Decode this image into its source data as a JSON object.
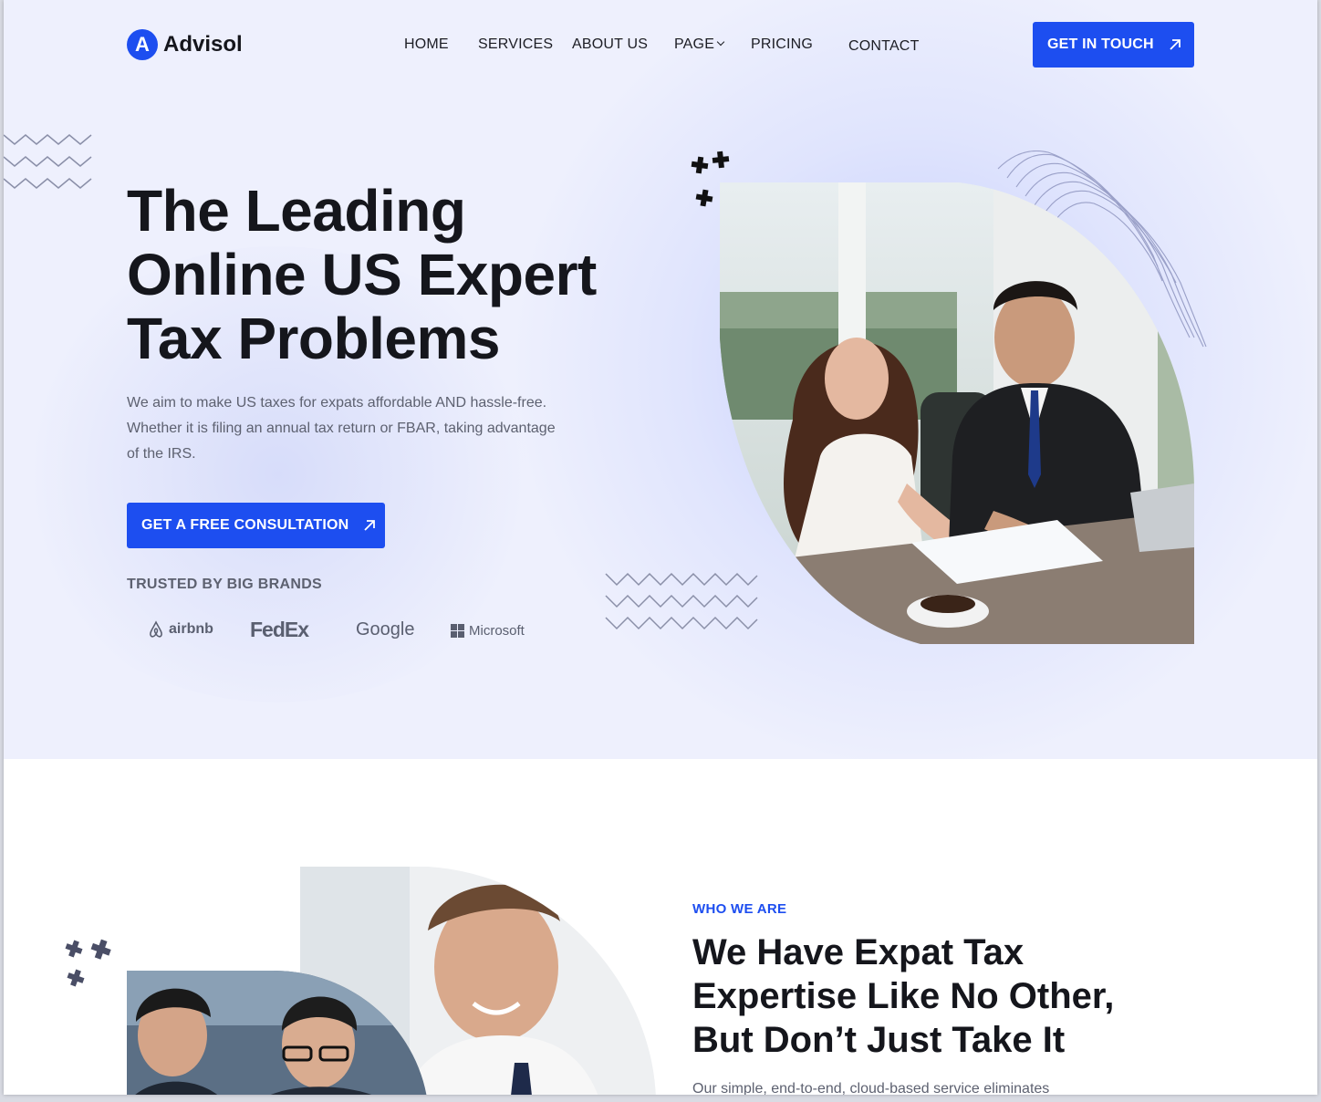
{
  "brand": {
    "logo_letter": "A",
    "name": "Advisol"
  },
  "nav": {
    "home": "HOME",
    "services": "SERVICES",
    "about": "ABOUT US",
    "page": "PAGE",
    "pricing": "PRICING",
    "contact": "CONTACT"
  },
  "header_cta": "GET IN TOUCH",
  "hero": {
    "title_line1": "The Leading",
    "title_line2": "Online US Expert",
    "title_line3": "Tax Problems",
    "desc_line1": "We aim to make US taxes for expats affordable AND hassle-free.",
    "desc_line2": "Whether it is filing an annual tax return or FBAR, taking advantage",
    "desc_line3": "of the IRS.",
    "cta": "GET A FREE CONSULTATION",
    "trusted_label": "TRUSTED BY BIG BRANDS",
    "brands": [
      "airbnb",
      "FedEx",
      "Google",
      "Microsoft"
    ]
  },
  "who": {
    "label": "WHO WE ARE",
    "title_line1": "We Have Expat Tax",
    "title_line2": "Expertise Like No Other,",
    "title_line3": "But Don’t Just Take It",
    "desc": "Our simple, end-to-end, cloud-based service eliminates"
  },
  "colors": {
    "accent": "#1d4ef0",
    "hero_bg": "#eef0fd",
    "text_dark": "#15161c",
    "text_muted": "#5d6170"
  },
  "icons": [
    "arrow-up-right-icon",
    "chevron-down-icon",
    "sparkle-cross-icon",
    "zigzag-pattern",
    "wave-lines-pattern"
  ]
}
